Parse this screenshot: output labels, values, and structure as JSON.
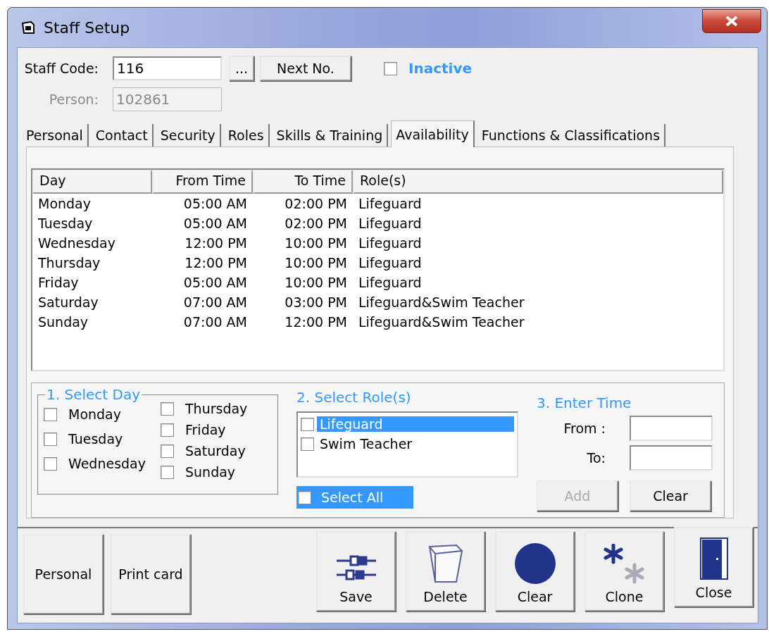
{
  "window": {
    "title": "Staff Setup"
  },
  "header": {
    "staff_code_label": "Staff Code:",
    "staff_code": "116",
    "browse_button": "...",
    "next_button": "Next No.",
    "inactive": {
      "label": "Inactive",
      "checked": false
    },
    "person_label": "Person:",
    "person": "102861"
  },
  "tabs": [
    {
      "label": "Personal",
      "selected": false
    },
    {
      "label": "Contact",
      "selected": false
    },
    {
      "label": "Security",
      "selected": false
    },
    {
      "label": "Roles",
      "selected": false
    },
    {
      "label": "Skills & Training",
      "selected": false
    },
    {
      "label": "Availability",
      "selected": true
    },
    {
      "label": "Functions & Classifications",
      "selected": false
    }
  ],
  "availability": {
    "columns": [
      "Day",
      "From Time",
      "To Time",
      "Role(s)"
    ],
    "rows": [
      [
        "Monday",
        "05:00 AM",
        "02:00 PM",
        "Lifeguard"
      ],
      [
        "Tuesday",
        "05:00 AM",
        "02:00 PM",
        "Lifeguard"
      ],
      [
        "Wednesday",
        "12:00 PM",
        "10:00 PM",
        "Lifeguard"
      ],
      [
        "Thursday",
        "12:00 PM",
        "10:00 PM",
        "Lifeguard"
      ],
      [
        "Friday",
        "05:00 AM",
        "10:00 PM",
        "Lifeguard"
      ],
      [
        "Saturday",
        "07:00 AM",
        "03:00 PM",
        "Lifeguard&Swim Teacher"
      ],
      [
        "Sunday",
        "07:00 AM",
        "12:00 PM",
        "Lifeguard&Swim Teacher"
      ]
    ]
  },
  "select_day": {
    "title": "1. Select Day",
    "days": [
      {
        "label": "Monday",
        "checked": false
      },
      {
        "label": "Tuesday",
        "checked": false
      },
      {
        "label": "Wednesday",
        "checked": false
      },
      {
        "label": "Thursday",
        "checked": false
      },
      {
        "label": "Friday",
        "checked": false
      },
      {
        "label": "Saturday",
        "checked": false
      },
      {
        "label": "Sunday",
        "checked": false
      }
    ]
  },
  "select_roles": {
    "title": "2. Select Role(s)",
    "roles": [
      {
        "label": "Lifeguard",
        "checked": false,
        "selected": true
      },
      {
        "label": "Swim Teacher",
        "checked": false,
        "selected": false
      }
    ],
    "select_all": {
      "label": "Select All",
      "checked": false,
      "focused": true
    }
  },
  "enter_time": {
    "title": "3. Enter Time",
    "from_label": "From :",
    "to_label": "To:",
    "add_button": {
      "label": "Add",
      "disabled": true
    },
    "clear_button": {
      "label": "Clear",
      "disabled": false
    }
  },
  "buttons": [
    {
      "label": "Personal",
      "kind": "text"
    },
    {
      "label": "Print card",
      "kind": "text"
    },
    {
      "label": "Save",
      "kind": "save"
    },
    {
      "label": "Delete",
      "kind": "delete"
    },
    {
      "label": "Clear",
      "kind": "clear"
    },
    {
      "label": "Clone",
      "kind": "clone"
    },
    {
      "label": "Close",
      "kind": "close"
    }
  ]
}
